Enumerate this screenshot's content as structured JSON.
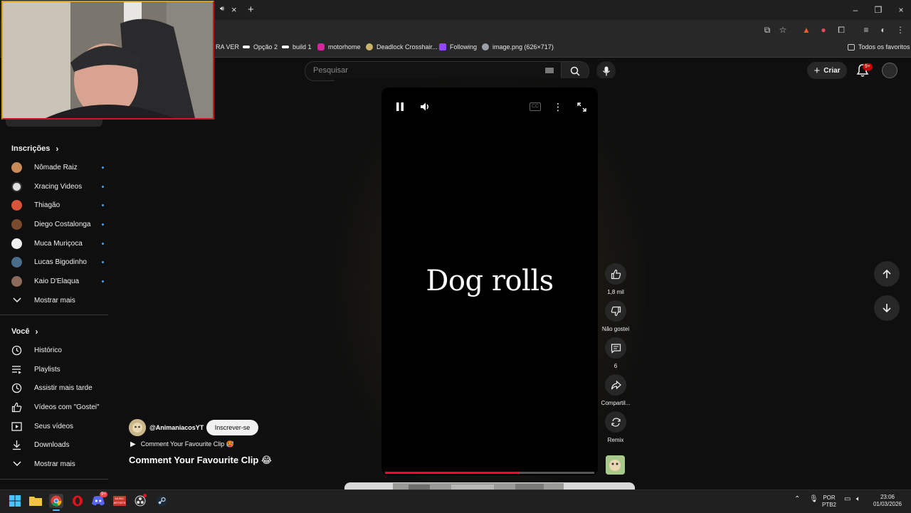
{
  "browser": {
    "tab_close": "×",
    "new_tab": "+",
    "window_controls": [
      "–",
      "❐",
      "×"
    ],
    "bookmarks": [
      {
        "label": "RA VER",
        "icon": "none",
        "color": "#282828"
      },
      {
        "label": "Opção 2",
        "icon": "logo-icon",
        "color": "#ffffff"
      },
      {
        "label": "build 1",
        "icon": "logo-icon",
        "color": "#ffffff"
      },
      {
        "label": "motorhome",
        "icon": "instagram-icon",
        "color": "#d6249f"
      },
      {
        "label": "Deadlock Crosshair...",
        "icon": "gear-icon",
        "color": "#c9b36a"
      },
      {
        "label": "Following",
        "icon": "twitch-icon",
        "color": "#9146ff"
      },
      {
        "label": "image.png (626×717)",
        "icon": "globe-icon",
        "color": "#9aa0a6"
      }
    ],
    "all_bookmarks": "Todos os favoritos"
  },
  "header": {
    "search_placeholder": "Pesquisar",
    "create_label": "Criar",
    "notifications_badge": "9+"
  },
  "sidebar": {
    "subscriptions_title": "Inscrições",
    "subscriptions": [
      {
        "label": "Nômade Raiz",
        "color": "#c98a5a"
      },
      {
        "label": "Xracing Videos",
        "color": "#e0e0e0"
      },
      {
        "label": "Thiagão",
        "color": "#d9533b"
      },
      {
        "label": "Diego Costalonga",
        "color": "#7a4a2e"
      },
      {
        "label": "Muca Muriçoca",
        "color": "#f0f0f0"
      },
      {
        "label": "Lucas Bigodinho",
        "color": "#4a6d8c"
      },
      {
        "label": "Kaio D'Elaqua",
        "color": "#8c6b5a"
      }
    ],
    "show_more_1": "Mostrar mais",
    "you_title": "Você",
    "you_items": [
      {
        "label": "Histórico",
        "icon": "history-icon"
      },
      {
        "label": "Playlists",
        "icon": "playlists-icon"
      },
      {
        "label": "Assistir mais tarde",
        "icon": "clock-icon"
      },
      {
        "label": "Vídeos com \"Gostei\"",
        "icon": "thumbs-up-icon"
      },
      {
        "label": "Seus vídeos",
        "icon": "video-icon"
      },
      {
        "label": "Downloads",
        "icon": "download-icon"
      }
    ],
    "show_more_2": "Mostrar mais"
  },
  "player": {
    "overlay_text": "Dog rolls",
    "progress": 0.64,
    "cc_label": "CC"
  },
  "actions": {
    "likes": "1,8 mil",
    "dislike": "Não gostei",
    "comments": "6",
    "share": "Compartil...",
    "remix": "Remix"
  },
  "channel": {
    "handle": "@AnimaniacosYT",
    "subscribe": "Inscrever-se",
    "music_line": "Comment Your Favourite Clip 🥵",
    "short_title": "Comment Your Favourite Clip 😂"
  },
  "taskbar": {
    "lang_top": "POR",
    "lang_bottom": "PTB2",
    "time": "23:06",
    "date": "01/03/2026",
    "discord_badge": "9+",
    "app_label": "MUSIC ARTISTS"
  },
  "colors": {
    "accent_red": "#ff0033",
    "subscribe_dot": "#3ea6ff",
    "webcam_border_top": "#d4a017",
    "webcam_border_bottom": "#c71a1a"
  }
}
